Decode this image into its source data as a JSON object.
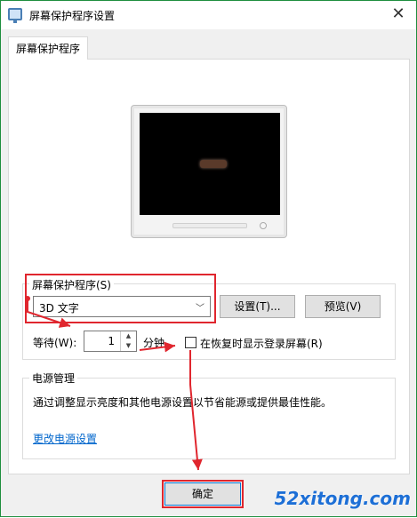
{
  "window": {
    "title": "屏幕保护程序设置",
    "close_glyph": "✕"
  },
  "tabs": [
    {
      "label": "屏幕保护程序"
    }
  ],
  "screensaver": {
    "group_label": "屏幕保护程序(S)",
    "selected": "3D 文字",
    "settings_label": "设置(T)...",
    "preview_label": "预览(V)",
    "wait_label": "等待(W):",
    "wait_value": "1",
    "minutes_label": "分钟",
    "resume_label": "在恢复时显示登录屏幕(R)",
    "resume_checked": false
  },
  "power": {
    "group_label": "电源管理",
    "description": "通过调整显示亮度和其他电源设置以节省能源或提供最佳性能。",
    "link": "更改电源设置"
  },
  "footer": {
    "ok_label": "确定"
  },
  "watermark": "52xitong.com",
  "annotation_color": "#e0262e"
}
